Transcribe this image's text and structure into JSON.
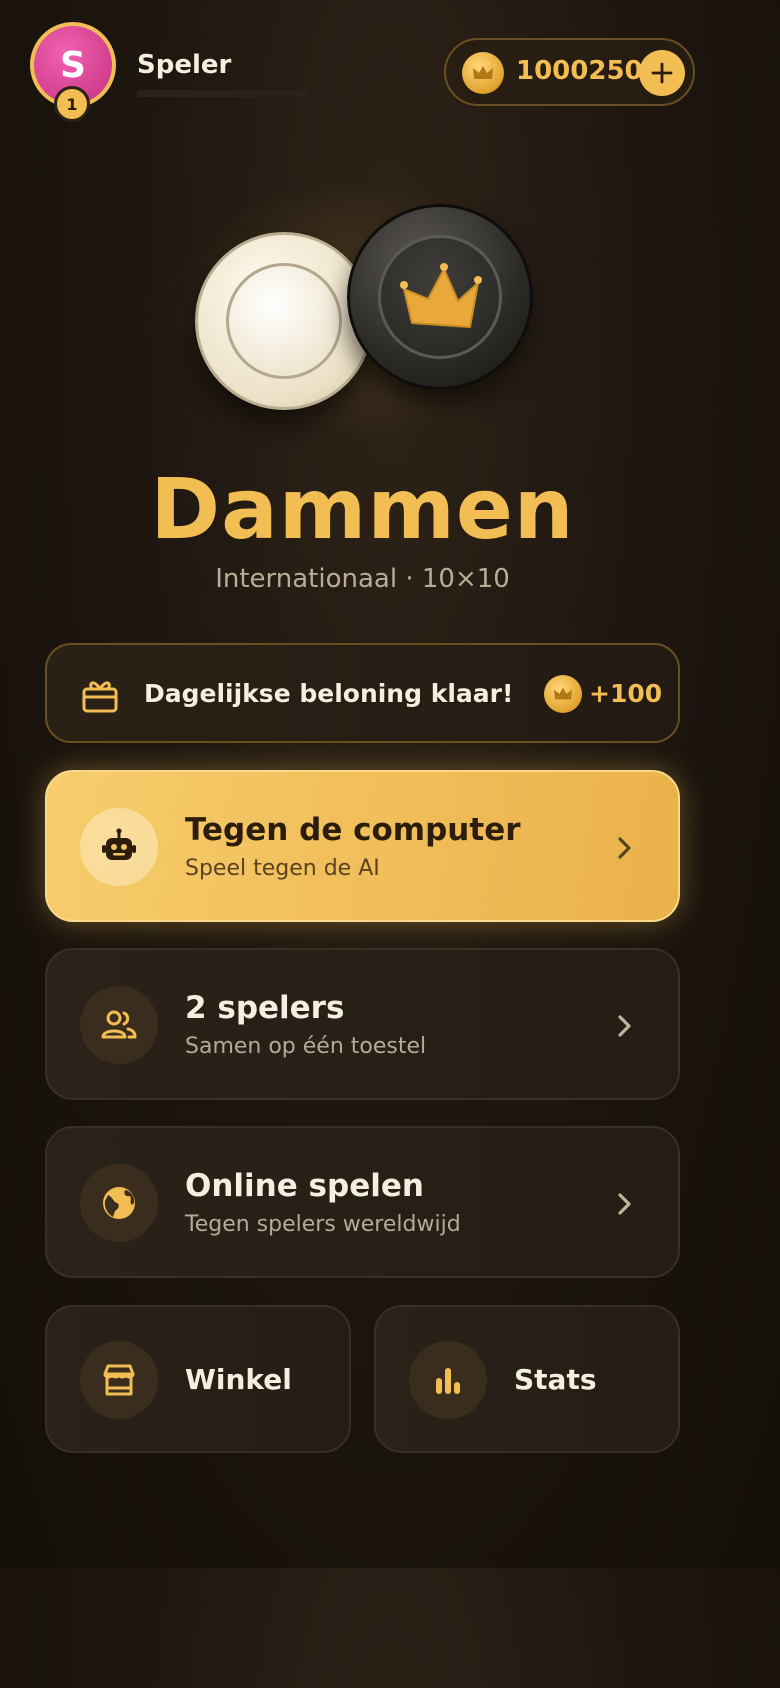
{
  "player": {
    "avatar_letter": "S",
    "level": "1",
    "name": "Speler",
    "xp_progress": 0
  },
  "wallet": {
    "coins": "1000250",
    "coin_icon": "crown-coin-icon",
    "add_icon": "plus-icon"
  },
  "hero": {
    "title": "Dammen",
    "subtitle": "Internationaal · 10×10"
  },
  "daily_reward": {
    "icon": "gift-icon",
    "label": "Dagelijkse beloning klaar!",
    "amount": "+100"
  },
  "menu": [
    {
      "icon": "robot-icon",
      "title": "Tegen de computer",
      "subtitle": "Speel tegen de AI"
    },
    {
      "icon": "users-icon",
      "title": "2 spelers",
      "subtitle": "Samen op één toestel"
    },
    {
      "icon": "globe-icon",
      "title": "Online spelen",
      "subtitle": "Tegen spelers wereldwijd"
    }
  ],
  "tiles": [
    {
      "icon": "store-icon",
      "label": "Winkel"
    },
    {
      "icon": "bar-chart-icon",
      "label": "Stats"
    }
  ],
  "colors": {
    "accent": "#f2bd52",
    "background": "#1e1710",
    "avatar": "#d93d92"
  }
}
